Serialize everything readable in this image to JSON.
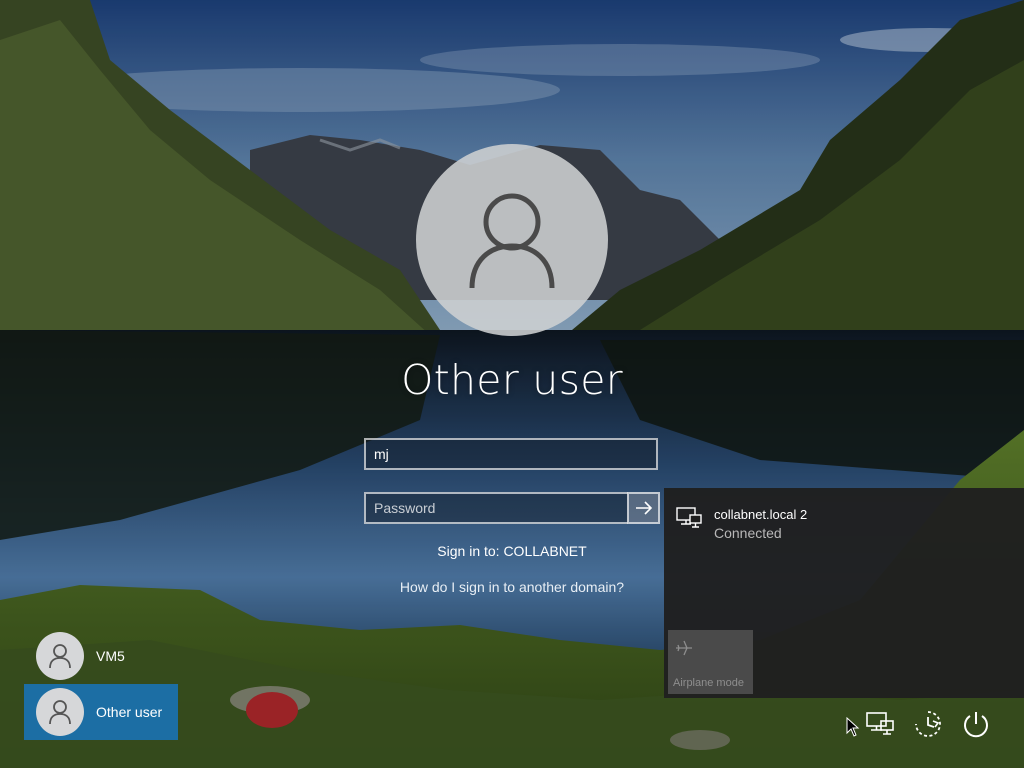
{
  "login": {
    "user_display_name": "Other user",
    "username_value": "mj",
    "password_placeholder": "Password",
    "sign_in_to": "Sign in to: COLLABNET",
    "other_domain_link": "How do I sign in to another domain?"
  },
  "user_switcher": [
    {
      "label": "VM5",
      "selected": false
    },
    {
      "label": "Other user",
      "selected": true
    }
  ],
  "network_flyout": {
    "network_name": "collabnet.local 2",
    "network_status": "Connected",
    "airplane_mode_label": "Airplane mode"
  },
  "tray": {
    "icons": [
      "network-icon",
      "ease-of-access-icon",
      "power-icon"
    ]
  },
  "colors": {
    "selected_tile": "#1c6ea4",
    "flyout_bg": "#1f1f1f",
    "airplane_tile": "#4a4a4a"
  }
}
